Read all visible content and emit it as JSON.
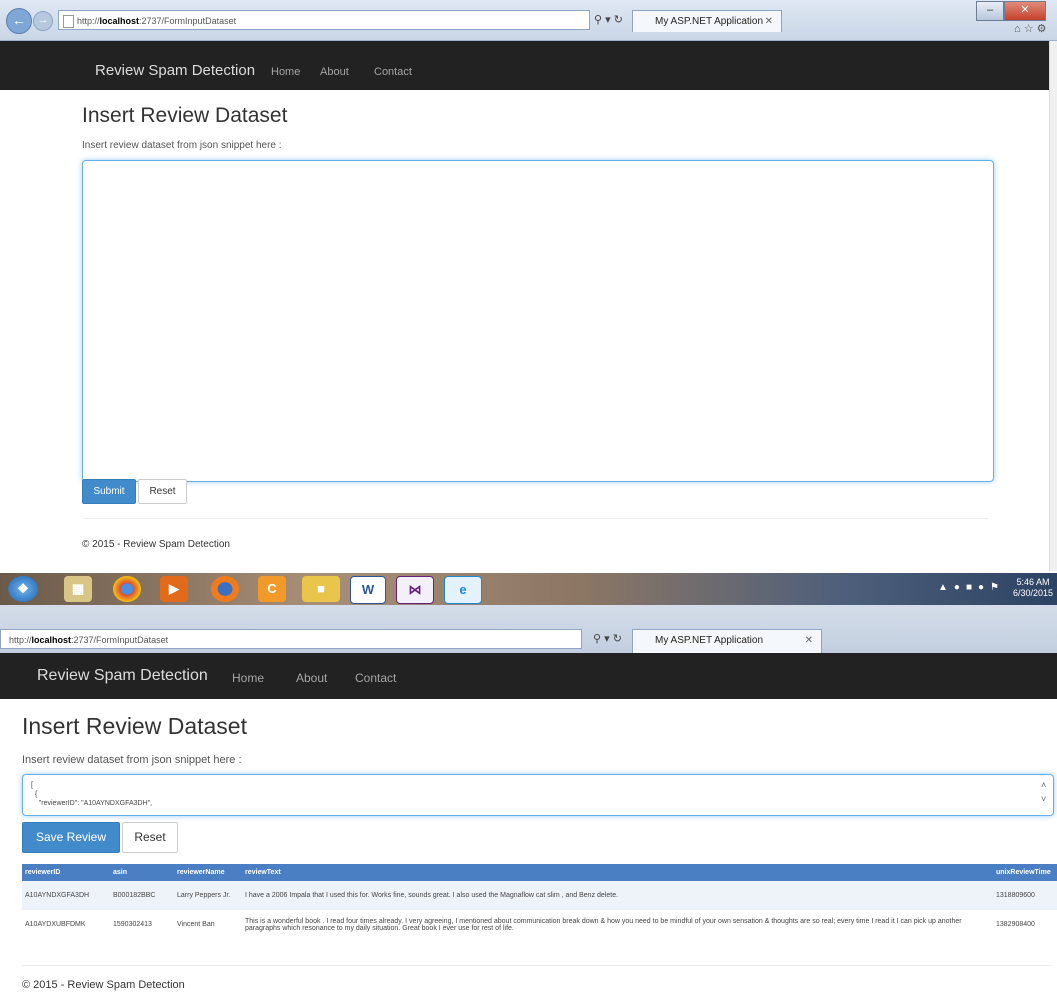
{
  "window1": {
    "address": {
      "prefix": "http://",
      "host": "localhost",
      "path": ":2737/FormInputDataset"
    },
    "tab_label": "My ASP.NET Application",
    "navbar": {
      "brand": "Review Spam Detection",
      "links": [
        "Home",
        "About",
        "Contact"
      ]
    },
    "title": "Insert Review Dataset",
    "hint": "Insert review dataset from json snippet here :",
    "textarea_value": "",
    "buttons": {
      "submit": "Submit",
      "reset": "Reset"
    },
    "footer": "© 2015 - Review Spam Detection"
  },
  "taskbar": {
    "apps": [
      "windows-start",
      "file-explorer",
      "chrome",
      "media-player",
      "firefox",
      "app-orange",
      "folder",
      "word",
      "visual-studio",
      "internet-explorer"
    ],
    "clock": {
      "time": "5:46 AM",
      "date": "6/30/2015"
    }
  },
  "window2": {
    "address": {
      "prefix": "http://",
      "host": "localhost",
      "path": ":2737/FormInputDataset"
    },
    "tab_label": "My ASP.NET Application",
    "navbar": {
      "brand": "Review Spam Detection",
      "links": [
        "Home",
        "About",
        "Contact"
      ]
    },
    "title": "Insert Review Dataset",
    "hint": "Insert review dataset from json snippet here :",
    "textarea_value": "[\n  {\n    \"reviewerID\": \"A10AYNDXGFA3DH\",",
    "buttons": {
      "save": "Save Review",
      "reset": "Reset"
    },
    "table": {
      "headers": [
        "reviewerID",
        "asin",
        "reviewerName",
        "reviewText",
        "unixReviewTime"
      ],
      "rows": [
        [
          "A10AYNDXGFA3DH",
          "B000182BBC",
          "Larry Peppers Jr.",
          "I have a 2006 Impala that I used this for. Works fine, sounds great. I also used the Magnaflow cat slim , and Benz delete.",
          "1318809600"
        ],
        [
          "A10AYDXUBFDMK",
          "1590302413",
          "Vincent Ban",
          "This is a wonderful book . I read four times already. I very agreeing, I mentioned about communication break down & how you need to be mindful of your own sensation & thoughts are so real; every time I read it I can pick up another paragraphs which resonance to my daily situation. Great book I ever use for rest of life.",
          "1382908400"
        ]
      ]
    },
    "footer": "© 2015 - Review Spam Detection"
  },
  "colors": {
    "navbar": "#222222",
    "primary": "#428bca",
    "table_header": "#4a7fc4"
  }
}
